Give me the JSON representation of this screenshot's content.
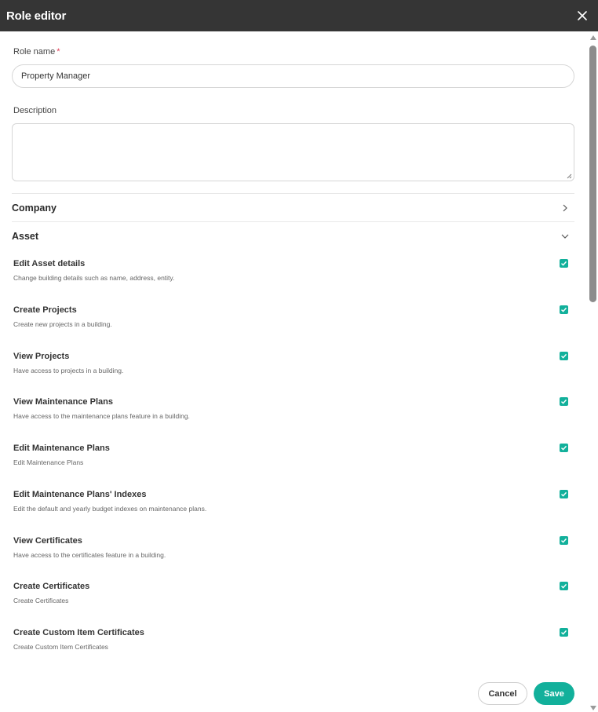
{
  "window": {
    "title": "Role editor",
    "close_icon": "close-icon"
  },
  "form": {
    "role_name": {
      "label": "Role name",
      "required_mark": "*",
      "value": "Property Manager"
    },
    "description": {
      "label": "Description",
      "value": ""
    }
  },
  "sections": {
    "company": {
      "label": "Company",
      "state": "collapsed",
      "icon": "chevron-right-icon"
    },
    "asset": {
      "label": "Asset",
      "state": "expanded",
      "icon": "chevron-down-icon"
    }
  },
  "asset_permissions": [
    {
      "title": "Edit Asset details",
      "description": "Change building details such as name, address, entity.",
      "checked": true
    },
    {
      "title": "Create Projects",
      "description": "Create new projects in a building.",
      "checked": true
    },
    {
      "title": "View Projects",
      "description": "Have access to projects in a building.",
      "checked": true
    },
    {
      "title": "View Maintenance Plans",
      "description": "Have access to the maintenance plans feature in a building.",
      "checked": true
    },
    {
      "title": "Edit Maintenance Plans",
      "description": "Edit Maintenance Plans",
      "checked": true
    },
    {
      "title": "Edit Maintenance Plans' Indexes",
      "description": "Edit the default and yearly budget indexes on maintenance plans.",
      "checked": true
    },
    {
      "title": "View Certificates",
      "description": "Have access to the certificates feature in a building.",
      "checked": true
    },
    {
      "title": "Create Certificates",
      "description": "Create Certificates",
      "checked": true
    },
    {
      "title": "Create Custom Item Certificates",
      "description": "Create Custom Item Certificates",
      "checked": true
    }
  ],
  "actions": {
    "cancel_label": "Cancel",
    "save_label": "Save"
  },
  "colors": {
    "titlebar": "#353535",
    "accent": "#12b09b",
    "required": "#e0405a"
  }
}
